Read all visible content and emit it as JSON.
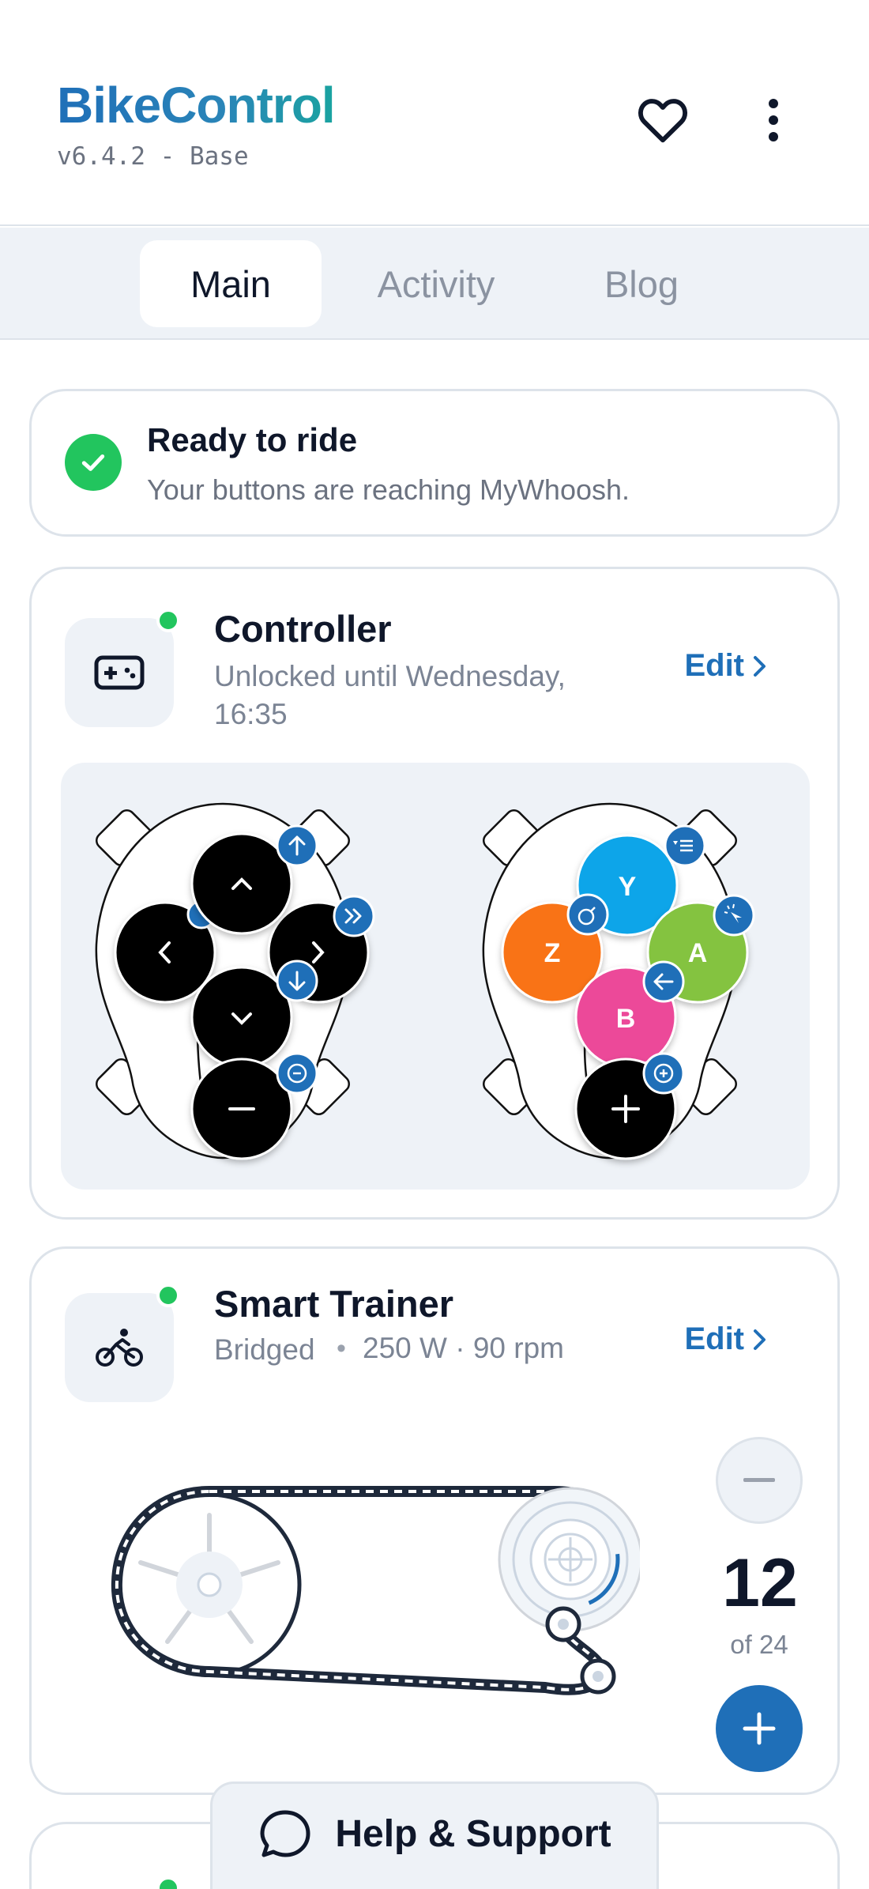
{
  "header": {
    "app_title": "BikeControl",
    "version": "v6.4.2 - Base",
    "favorite_icon": "heart-icon",
    "menu_icon": "more-vertical-icon"
  },
  "tabs": [
    {
      "label": "Main",
      "active": true
    },
    {
      "label": "Activity",
      "active": false
    },
    {
      "label": "Blog",
      "active": false
    }
  ],
  "status": {
    "title": "Ready to ride",
    "subtitle": "Your buttons are reaching MyWhoosh.",
    "icon": "check-icon",
    "color": "#22c55e"
  },
  "controller": {
    "title": "Controller",
    "subtitle": "Unlocked until Wednesday, 16:35",
    "edit_label": "Edit",
    "connected": true,
    "icon": "gamepad-icon",
    "left_pad": {
      "buttons": [
        "up",
        "left",
        "right",
        "down",
        "minus"
      ],
      "badges": [
        "up-arrow-icon",
        "left-arrow-icon",
        "double-right-icon",
        "down-arrow-icon",
        "minus-circle-icon"
      ],
      "minus_label": "−"
    },
    "right_pad": {
      "buttons": [
        {
          "label": "Y",
          "color": "#0ea5e9"
        },
        {
          "label": "Z",
          "color": "#f97316"
        },
        {
          "label": "A",
          "color": "#84c341"
        },
        {
          "label": "B",
          "color": "#ec4899"
        },
        {
          "label": "+",
          "color": "#000000"
        }
      ],
      "badges": [
        "list-icon",
        "bomb-icon",
        "cursor-click-icon",
        "left-arrow-icon",
        "plus-circle-icon"
      ]
    }
  },
  "trainer": {
    "title": "Smart Trainer",
    "status": "Bridged",
    "stats": "250 W · 90 rpm",
    "edit_label": "Edit",
    "connected": true,
    "icon": "bicycle-icon",
    "gear_current": "12",
    "gear_total_label": "of 24",
    "gear_fraction": 0.5
  },
  "help": {
    "label": "Help & Support",
    "icon": "chat-bubble-icon"
  },
  "colors": {
    "accent": "#1f6fb8",
    "success": "#22c55e",
    "muted": "#6b7280",
    "panel": "#eef2f7"
  }
}
